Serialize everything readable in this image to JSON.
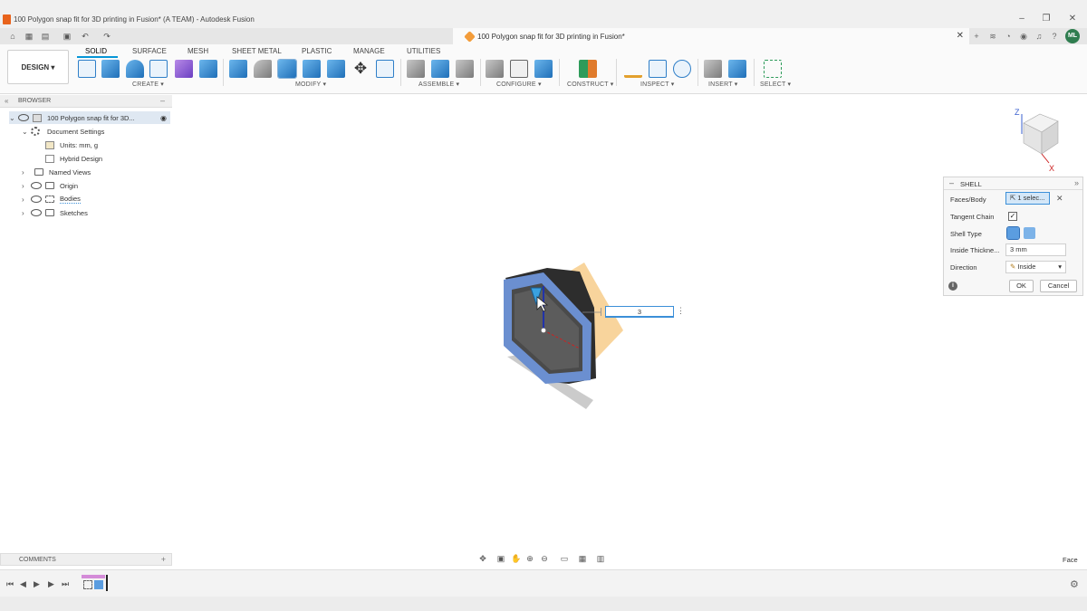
{
  "window": {
    "title": "100 Polygon snap fit for 3D printing in Fusion* (A TEAM) - Autodesk Fusion",
    "controls": [
      "–",
      "❐",
      "✕"
    ]
  },
  "document_tab": {
    "title": "100 Polygon snap fit for 3D printing in Fusion*",
    "close": "✕"
  },
  "user": {
    "initials": "ML"
  },
  "ribbon": {
    "workspace": "DESIGN ▾",
    "tabs": [
      "SOLID",
      "SURFACE",
      "MESH",
      "SHEET METAL",
      "PLASTIC",
      "MANAGE",
      "UTILITIES"
    ],
    "groups": [
      "CREATE ▾",
      "MODIFY ▾",
      "ASSEMBLE ▾",
      "CONFIGURE ▾",
      "CONSTRUCT ▾",
      "INSPECT ▾",
      "INSERT ▾",
      "SELECT ▾"
    ]
  },
  "browser": {
    "title": "BROWSER",
    "root": "100 Polygon snap fit for 3D...",
    "document_settings": "Document Settings",
    "units": "Units: mm, g",
    "hybrid": "Hybrid Design",
    "named_views": "Named Views",
    "origin": "Origin",
    "bodies": "Bodies",
    "sketches": "Sketches"
  },
  "shell_dialog": {
    "title": "SHELL",
    "faces_label": "Faces/Body",
    "faces_value": "1 selec...",
    "tangent_label": "Tangent Chain",
    "tangent_checked": true,
    "shell_type_label": "Shell Type",
    "thickness_label": "Inside Thickne...",
    "thickness_value": "3 mm",
    "direction_label": "Direction",
    "direction_value": "Inside",
    "ok": "OK",
    "cancel": "Cancel"
  },
  "viewport": {
    "thickness_input": "3",
    "selection_filter": "Face"
  },
  "comments": {
    "title": "COMMENTS"
  },
  "colors": {
    "accent": "#0696d7",
    "body_face": "#6b8fd0",
    "body_dark": "#2d2d2d",
    "plane": "#f2b04a"
  }
}
